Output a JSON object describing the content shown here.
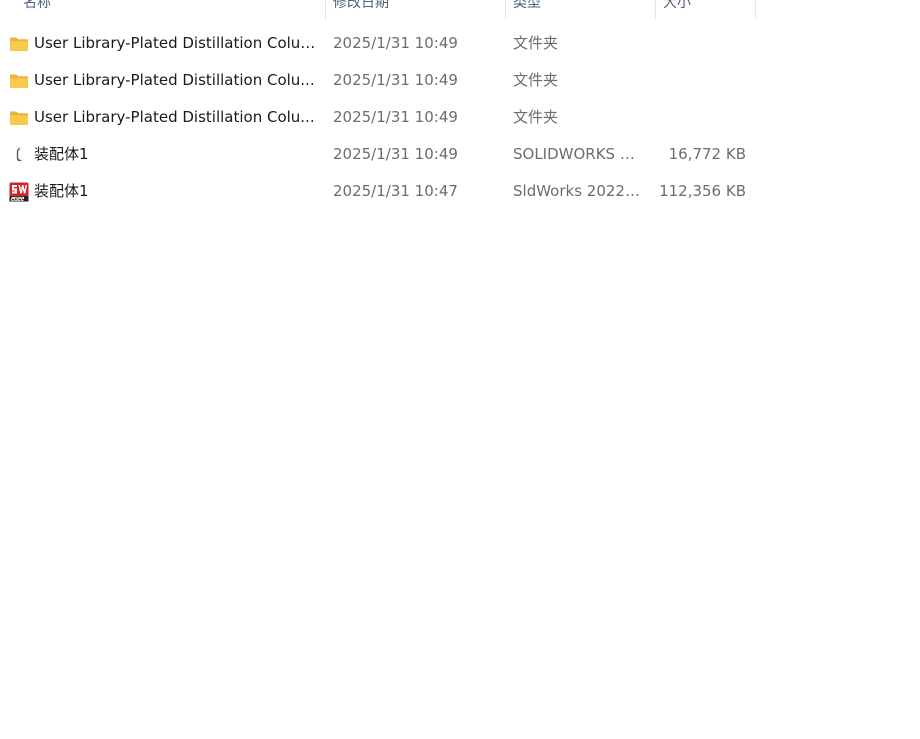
{
  "columns": {
    "name": "名称",
    "date": "修改日期",
    "type": "类型",
    "size": "大小"
  },
  "files": [
    {
      "icon": "folder-icon",
      "name": "User Library-Plated Distillation Column",
      "date": "2025/1/31 10:49",
      "type": "文件夹",
      "size": ""
    },
    {
      "icon": "folder-icon",
      "name": "User Library-Plated Distillation Colu...",
      "date": "2025/1/31 10:49",
      "type": "文件夹",
      "size": ""
    },
    {
      "icon": "folder-icon",
      "name": "User Library-Plated Distillation Colu...",
      "date": "2025/1/31 10:49",
      "type": "文件夹",
      "size": ""
    },
    {
      "icon": "solidworks-assembly-icon",
      "name": "装配体1",
      "date": "2025/1/31 10:49",
      "type": "SOLIDWORKS A...",
      "size": "16,772 KB"
    },
    {
      "icon": "sldworks-2022-icon",
      "name": "装配体1",
      "date": "2025/1/31 10:47",
      "type": "SldWorks 2022 ...",
      "size": "112,356 KB"
    }
  ],
  "colors": {
    "folder": "#F8C94A",
    "header_text": "#4C607A",
    "sw_red": "#D2232A"
  }
}
